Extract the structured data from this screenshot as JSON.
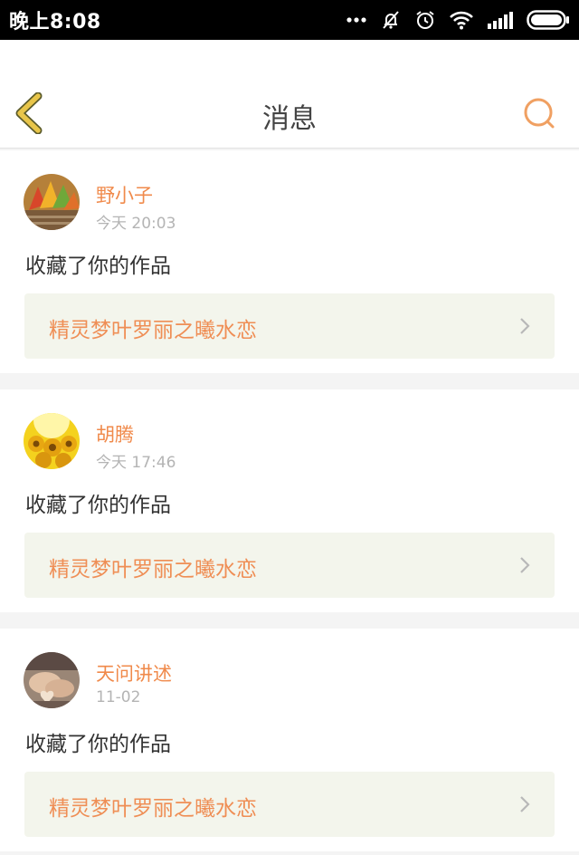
{
  "status_bar": {
    "time": "晚上8:08",
    "icons": [
      "more-dots-icon",
      "bell-muted-icon",
      "alarm-icon",
      "wifi-icon",
      "signal-icon",
      "battery-icon"
    ]
  },
  "header": {
    "title": "消息",
    "back_icon": "chevron-left-icon",
    "search_icon": "search-icon",
    "accent_back": "#e8c54a",
    "accent_search": "#f0a062"
  },
  "messages": [
    {
      "user": "野小子",
      "time": "今天 20:03",
      "action": "收藏了你的作品",
      "work": "精灵梦叶罗丽之曦水恋",
      "avatar": "avatar-autumn-leaves"
    },
    {
      "user": "胡腾",
      "time": "今天 17:46",
      "action": "收藏了你的作品",
      "work": "精灵梦叶罗丽之曦水恋",
      "avatar": "avatar-sunflowers"
    },
    {
      "user": "天问讲述",
      "time": "11-02",
      "action": "收藏了你的作品",
      "work": "精灵梦叶罗丽之曦水恋",
      "avatar": "avatar-hands-heart"
    }
  ],
  "colors": {
    "name": "#f08a4b",
    "work_title": "#ef8e55",
    "work_bg": "#f3f5ec",
    "page_bg": "#f4f4f4"
  }
}
